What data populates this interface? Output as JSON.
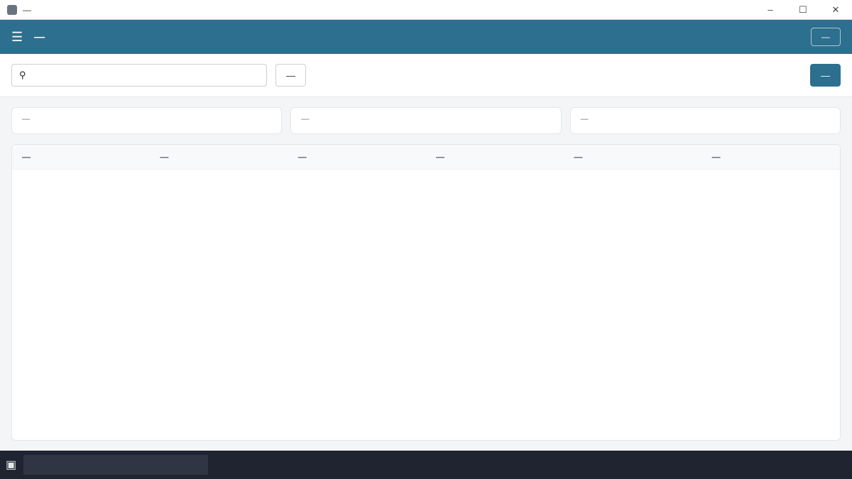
{
  "window": {
    "title": "—"
  },
  "header": {
    "title": "—",
    "logout_label": "—"
  },
  "toolbar": {
    "search_placeholder": "",
    "filter_label": "—",
    "schedule_label": "—"
  },
  "stats": [
    {
      "label": "—",
      "value": ""
    },
    {
      "label": "—",
      "value": ""
    },
    {
      "label": "—",
      "value": ""
    }
  ],
  "table": {
    "columns": [
      "—",
      "—",
      "—",
      "—",
      "—",
      "—"
    ],
    "rows": [],
    "empty_text": ""
  },
  "taskbar": {
    "search_placeholder": "",
    "apps": [],
    "time": "",
    "date": ""
  }
}
